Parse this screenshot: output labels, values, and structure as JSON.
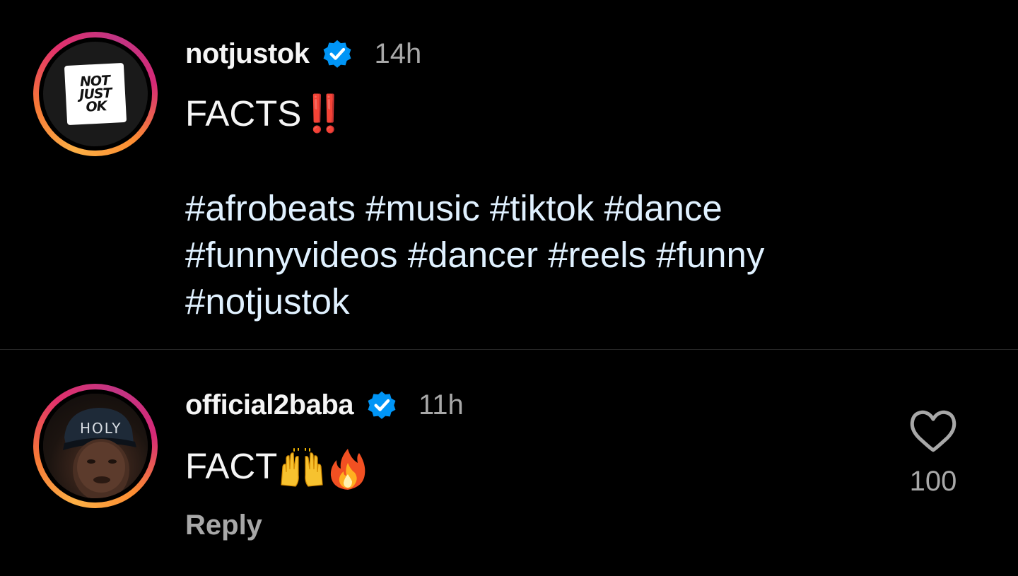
{
  "caption": {
    "username": "notjustok",
    "verified": true,
    "time": "14h",
    "avatar": {
      "logo_lines": [
        "NOT",
        "JUST",
        "OK"
      ]
    },
    "text": "FACTS",
    "emoji": "‼️",
    "hashtags_lines": [
      "#afrobeats #music #tiktok #dance",
      "#funnyvideos #dancer #reels #funny",
      "#notjustok"
    ]
  },
  "comment": {
    "username": "official2baba",
    "verified": true,
    "time": "11h",
    "avatar": {
      "cap_text": "HOLY"
    },
    "text": "FACT",
    "emojis": [
      "raising-hands",
      "fire"
    ],
    "reply_label": "Reply",
    "like_count": "100"
  },
  "colors": {
    "background": "#000000",
    "text": "#f5f5f5",
    "secondary_text": "#a8a8a8",
    "hashtag": "#e0f1ff",
    "verified_blue": "#0095f6",
    "divider": "#262626",
    "exclamation": "#e0282e"
  }
}
